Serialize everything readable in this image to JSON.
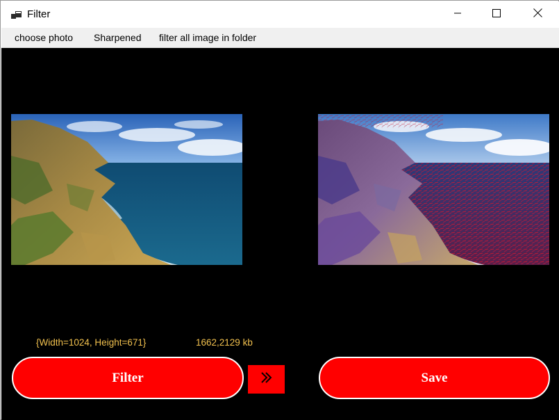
{
  "window": {
    "title": "Filter",
    "icon": "app-window-icon",
    "controls": [
      "minimize-icon",
      "maximize-icon",
      "close-icon"
    ]
  },
  "menu": {
    "items": [
      {
        "label": "choose photo"
      },
      {
        "label": "Sharpened"
      },
      {
        "label": "filter all image in folder"
      }
    ]
  },
  "images": {
    "original": {
      "icon": "original-photo"
    },
    "filtered": {
      "icon": "filtered-photo"
    }
  },
  "info": {
    "dimensions": "{Width=1024, Height=671}",
    "filesize": "1662,2129 kb"
  },
  "buttons": {
    "filter_label": "Filter",
    "save_label": "Save",
    "next_icon": "double-chevron-right-icon"
  },
  "colors": {
    "background": "#000000",
    "button_fill": "#ff0000",
    "button_text": "#ffffff",
    "info_text": "#f2c14e"
  }
}
